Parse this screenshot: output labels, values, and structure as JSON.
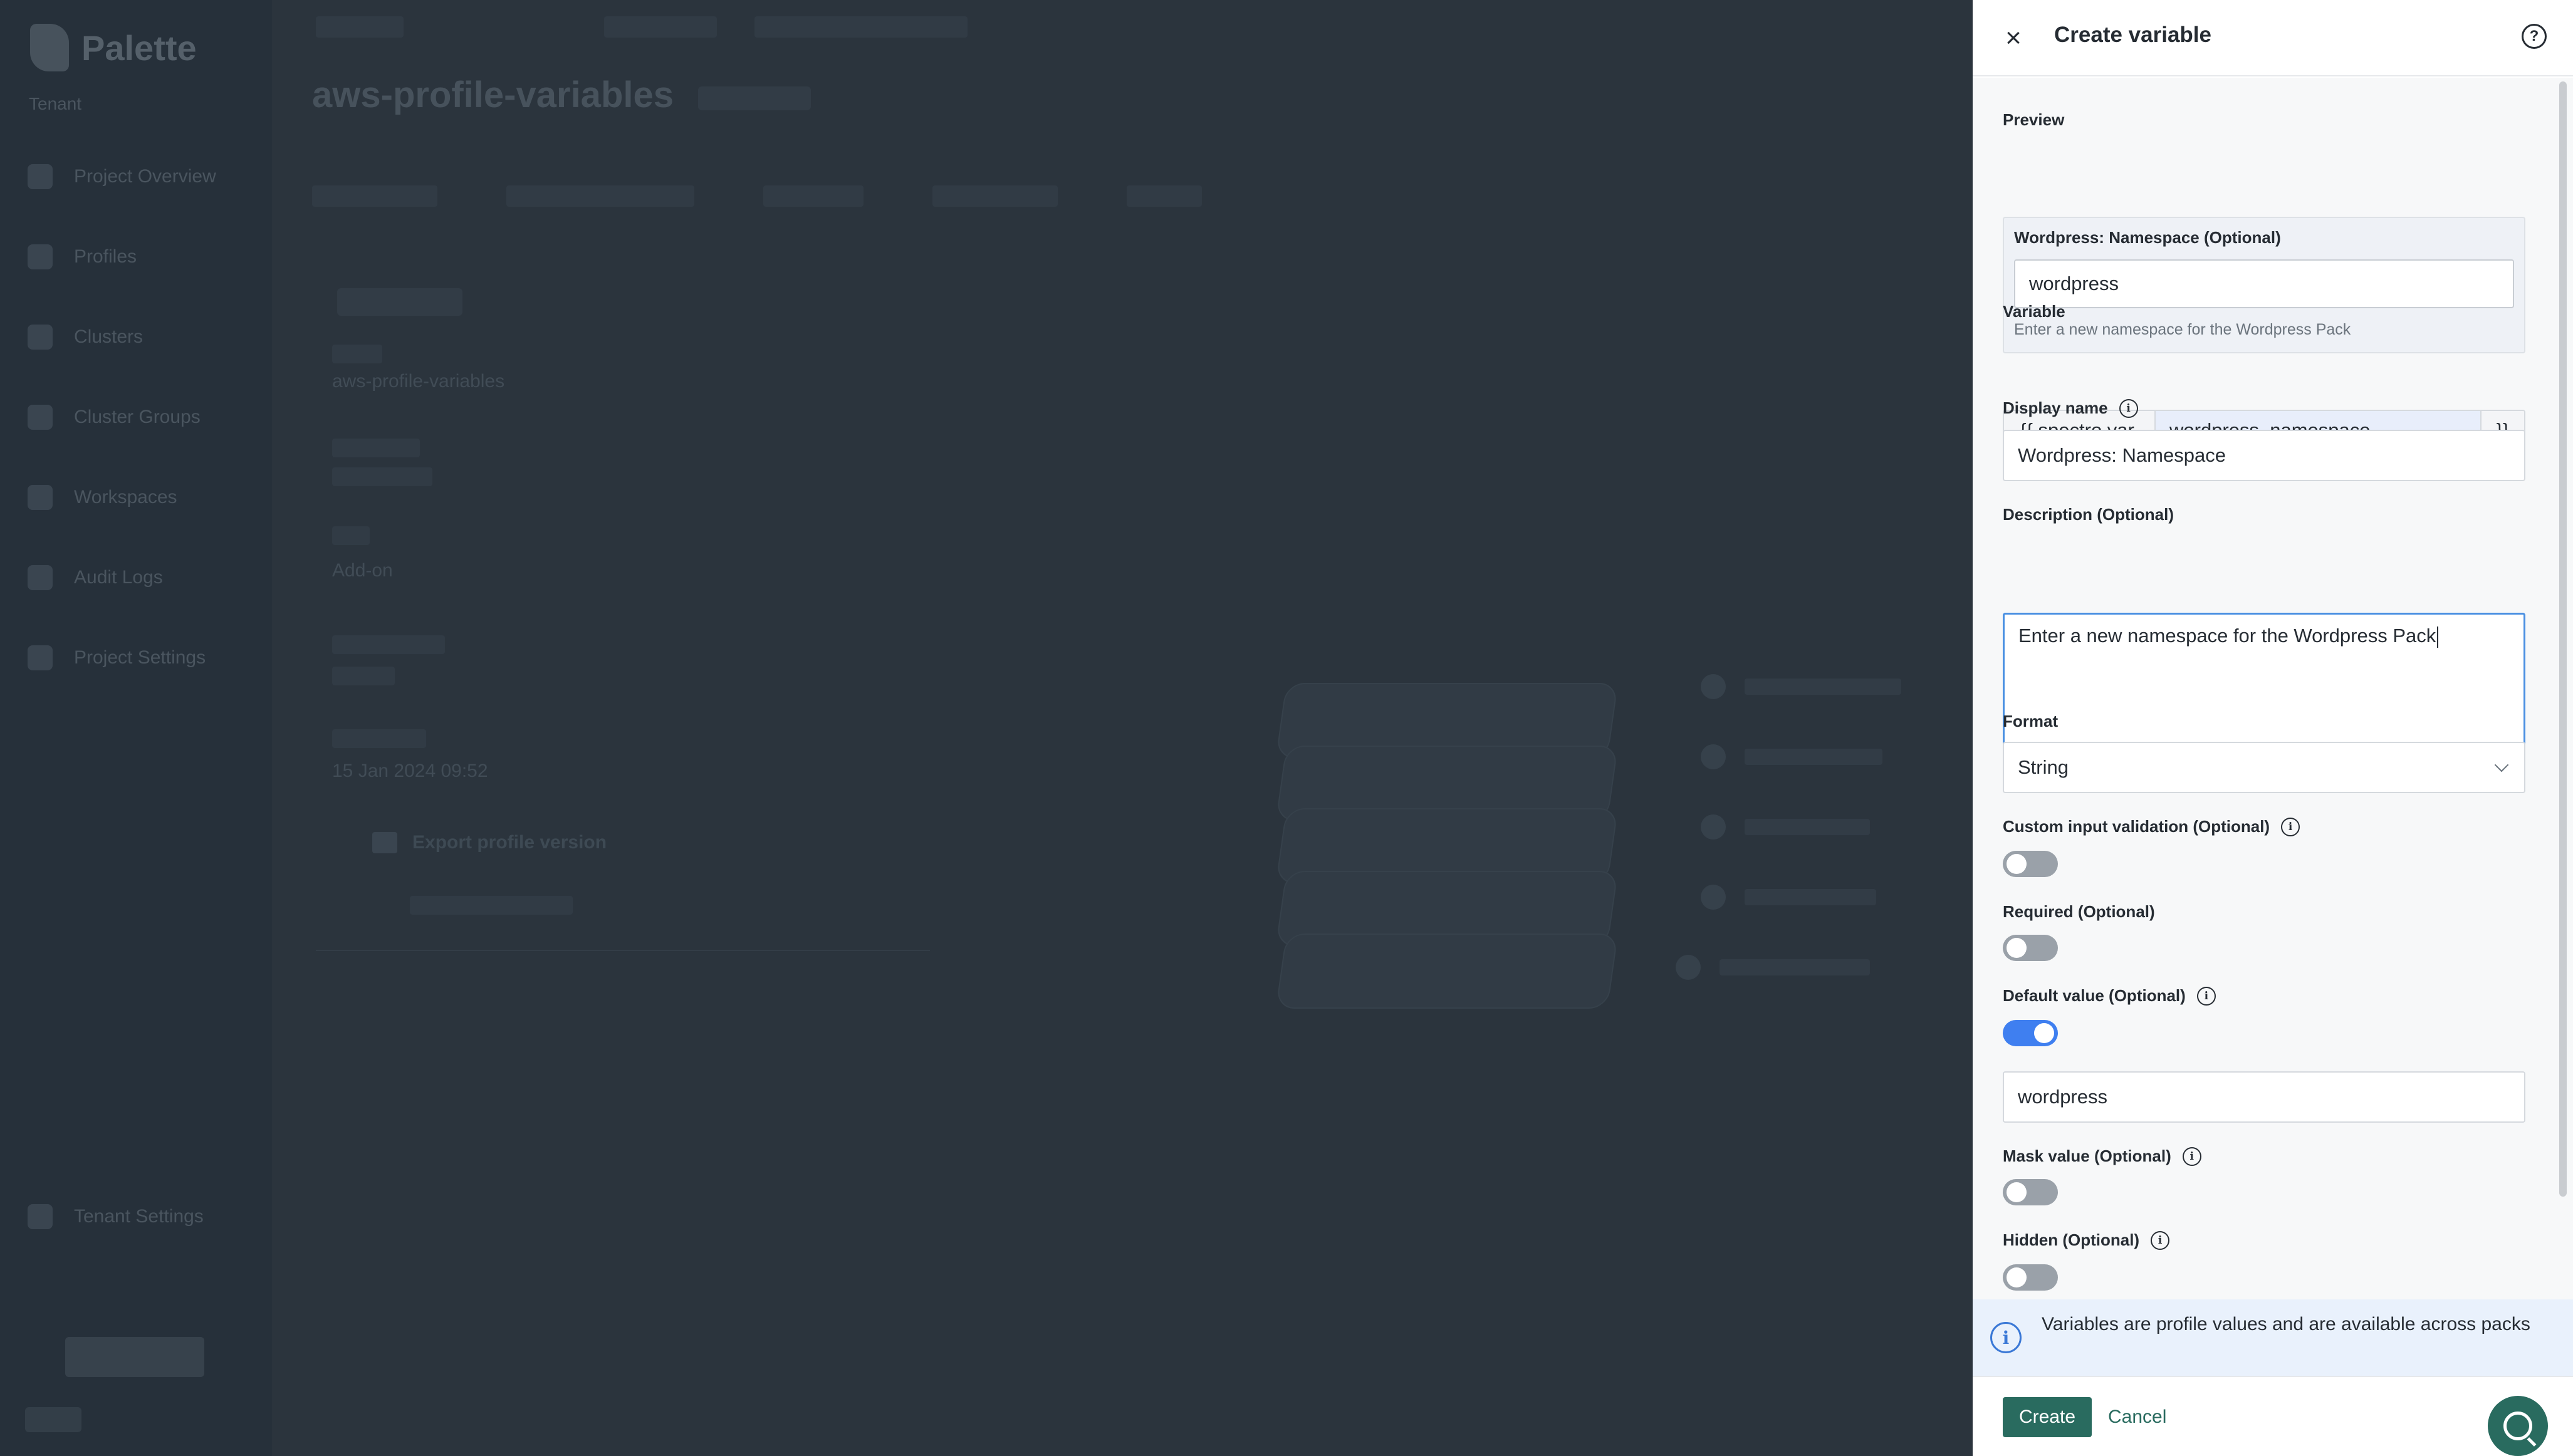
{
  "background": {
    "brand": "Palette",
    "scope": "Tenant",
    "nav_items": [
      "Project Overview",
      "Profiles",
      "Clusters",
      "Cluster Groups",
      "Workspaces",
      "Audit Logs",
      "Project Settings"
    ],
    "tenant_settings": "Tenant Settings",
    "profile_title": "aws-profile-variables",
    "field_value_1": "aws-profile-variables",
    "field_value_2": "Add-on",
    "field_value_3": "15 Jan 2024 09:52",
    "export_link": "Export profile version"
  },
  "drawer": {
    "title": "Create variable",
    "close_icon": "close-icon",
    "help_icon": "help-circle-icon"
  },
  "preview": {
    "section_label": "Preview",
    "field_label": "Wordpress: Namespace (Optional)",
    "value": "wordpress",
    "help_text": "Enter a new namespace for the Wordpress Pack"
  },
  "variable": {
    "label": "Variable",
    "prefix": "{{.spectro.var.",
    "name": "wordpress_namespace",
    "suffix": "}}"
  },
  "display_name": {
    "label": "Display name",
    "value": "Wordpress: Namespace"
  },
  "description": {
    "label": "Description (Optional)",
    "value": "Enter a new namespace for the Wordpress Pack"
  },
  "format": {
    "label": "Format",
    "selected": "String"
  },
  "custom_validation": {
    "label": "Custom input validation (Optional)",
    "enabled": false
  },
  "required": {
    "label": "Required (Optional)",
    "enabled": false
  },
  "default_value": {
    "label": "Default value (Optional)",
    "enabled": true,
    "value": "wordpress"
  },
  "mask_value": {
    "label": "Mask value (Optional)",
    "enabled": false
  },
  "hidden": {
    "label": "Hidden (Optional)",
    "enabled": false
  },
  "banner": {
    "icon": "info-icon",
    "text": "Variables are profile values and are available across packs"
  },
  "footer": {
    "create_label": "Create",
    "cancel_label": "Cancel",
    "chat_icon": "search-chat-icon"
  },
  "colors": {
    "primary": "#296b5f",
    "toggle_on": "#3f7ff0",
    "focus_border": "#4a90e2",
    "banner_bg": "#e9f1fc",
    "overlay": "#2c3640"
  }
}
